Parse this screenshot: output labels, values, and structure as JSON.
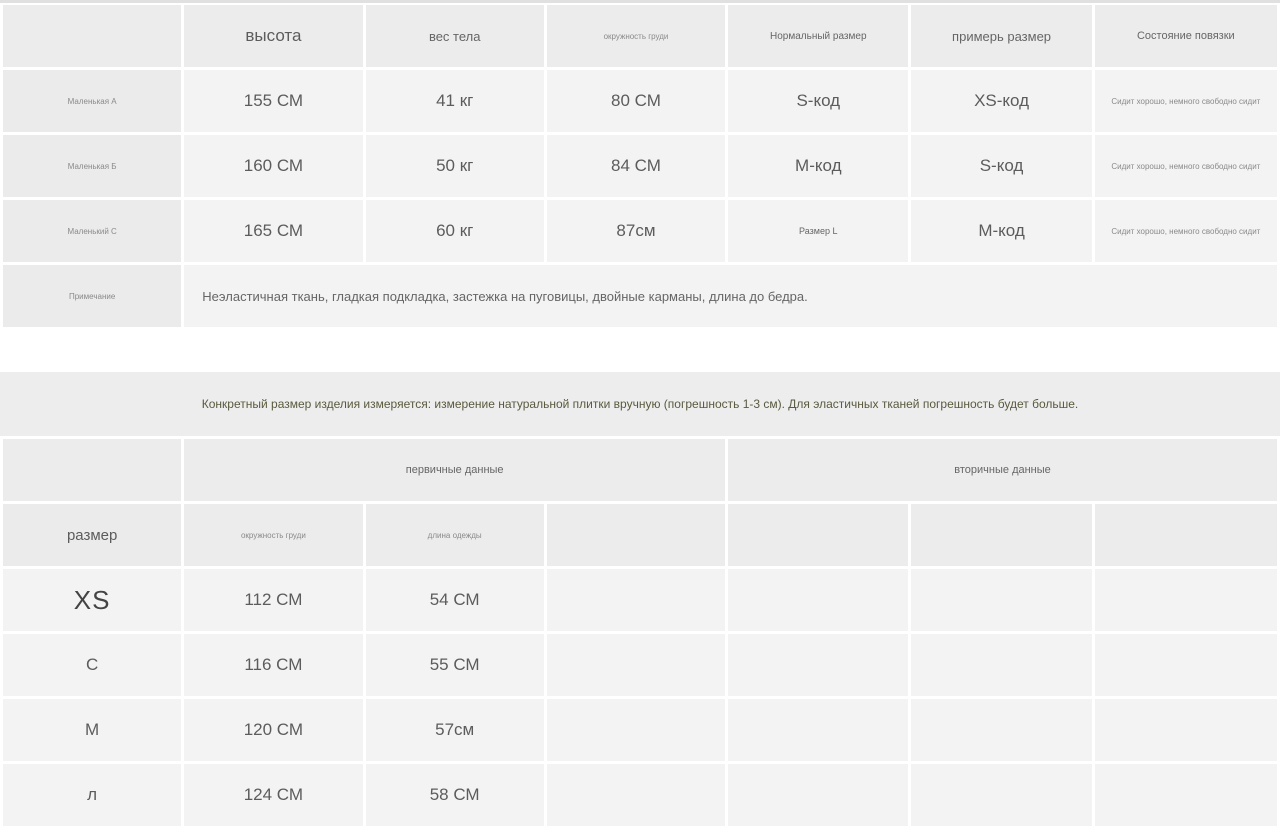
{
  "size_table": {
    "headers": [
      "",
      "высота",
      "вес тела",
      "окружность груди",
      "Нормальный размер",
      "примерь размер",
      "Состояние повязки"
    ],
    "rows": [
      {
        "label": "Маленькая А",
        "height": "155 СМ",
        "weight": "41 кг",
        "bust": "80 СМ",
        "normal": "S-код",
        "try": "XS-код",
        "fit": "Сидит хорошо, немного свободно сидит"
      },
      {
        "label": "Маленькая Б",
        "height": "160 СМ",
        "weight": "50 кг",
        "bust": "84 СМ",
        "normal": "М-код",
        "try": "S-код",
        "fit": "Сидит хорошо, немного свободно сидит"
      },
      {
        "label": "Маленький С",
        "height": "165 СМ",
        "weight": "60 кг",
        "bust": "87см",
        "normal": "Размер L",
        "try": "М-код",
        "fit": "Сидит хорошо, немного свободно сидит"
      }
    ],
    "note_label": "Примечание",
    "note_text": "Неэластичная ткань, гладкая подкладка, застежка на пуговицы, двойные карманы, длина до бедра."
  },
  "banner_text": "Конкретный размер изделия измеряется: измерение натуральной плитки вручную (погрешность 1-3 см). Для эластичных тканей погрешность будет больше.",
  "measure_table": {
    "group_primary": "первичные данные",
    "group_secondary": "вторичные данные",
    "size_label": "размер",
    "col_bust": "окружность груди",
    "col_length": "длина одежды",
    "rows": [
      {
        "size": "XS",
        "bust": "112 СМ",
        "length": "54 СМ"
      },
      {
        "size": "С",
        "bust": "116 СМ",
        "length": "55 СМ"
      },
      {
        "size": "М",
        "bust": "120 СМ",
        "length": "57см"
      },
      {
        "size": "л",
        "bust": "124 СМ",
        "length": "58 СМ"
      }
    ]
  }
}
